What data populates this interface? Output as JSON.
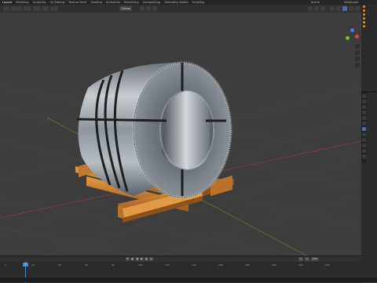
{
  "workspace_tabs": [
    "Layout",
    "Modeling",
    "Sculpting",
    "UV Editing",
    "Texture Paint",
    "Shading",
    "Animation",
    "Rendering",
    "Compositing",
    "Geometry Nodes",
    "Scripting"
  ],
  "active_tab_index": 0,
  "scene": {
    "label": "Scene"
  },
  "view_layer": {
    "label": "ViewLayer"
  },
  "header": {
    "mode": "Global"
  },
  "timeline": {
    "current_frame": "1",
    "start_frame": "1",
    "end_frame": "250",
    "ticks": [
      "0",
      "20",
      "40",
      "60",
      "80",
      "100",
      "120",
      "140",
      "160",
      "180",
      "200",
      "220",
      "240"
    ]
  },
  "colors": {
    "accent": "#4a8bd6",
    "gizmo_x": "#d44b4b",
    "gizmo_y": "#7ab843",
    "gizmo_z": "#4a78d6",
    "wood": "#c77a2d",
    "steel": "#9aa0a6"
  },
  "icons": {
    "viewport": [
      "select-icon",
      "cursor-icon",
      "move-icon",
      "rotate-icon",
      "scale-icon",
      "transform-icon",
      "annotate-icon",
      "measure-icon"
    ],
    "props_tabs": [
      "tool-icon",
      "render-icon",
      "output-icon",
      "view-layer-icon",
      "scene-icon",
      "world-icon",
      "object-icon",
      "modifier-icon",
      "physics-icon",
      "constraint-icon",
      "data-icon",
      "material-icon"
    ]
  }
}
